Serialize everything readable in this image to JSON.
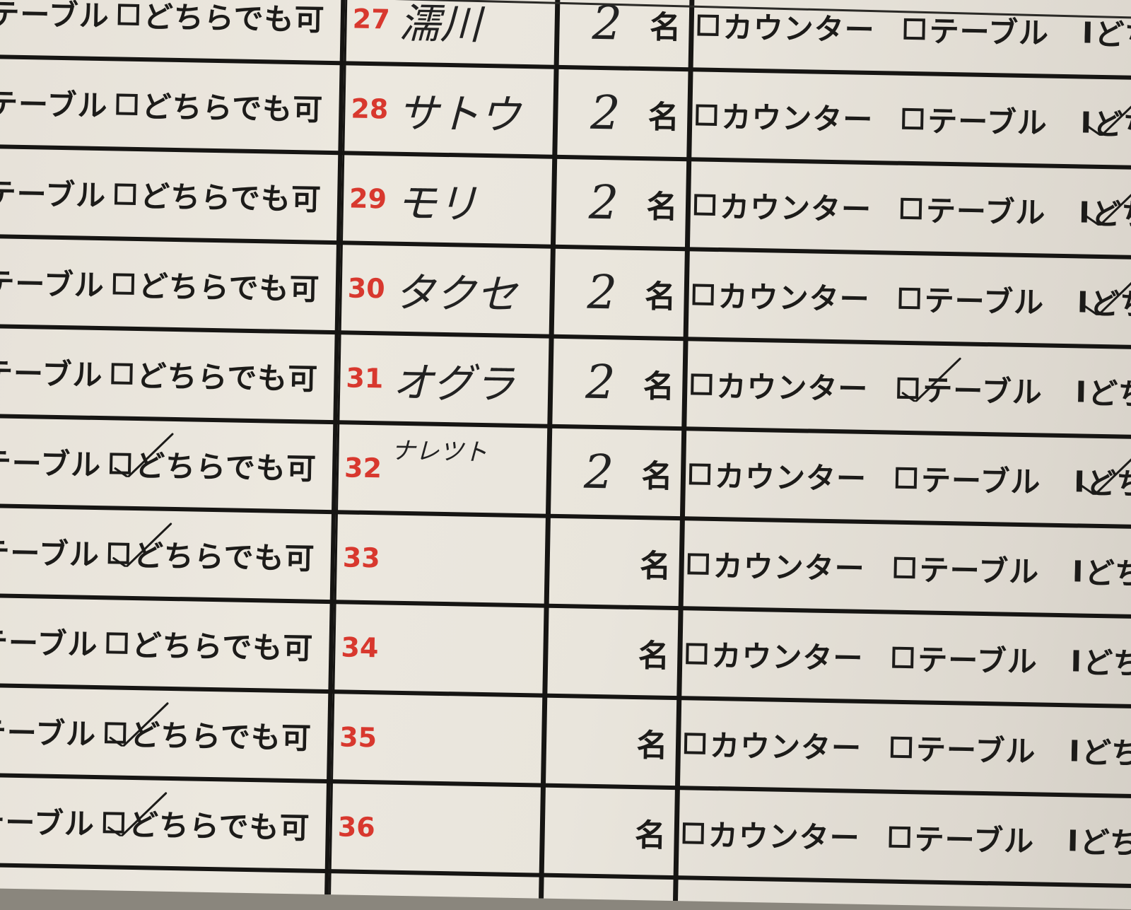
{
  "left_column": {
    "table_label": "テーブル",
    "either_label": "どちらでも可"
  },
  "labels": {
    "persons_unit": "名",
    "counter": "カウンター",
    "table": "テーブル",
    "either": "どちらでも可"
  },
  "reservations": [
    {
      "no": "27",
      "name": "濡川",
      "party": "2"
    },
    {
      "no": "28",
      "name": "サトウ",
      "party": "2"
    },
    {
      "no": "29",
      "name": "モリ",
      "party": "2"
    },
    {
      "no": "30",
      "name": "タクセ",
      "party": "2"
    },
    {
      "no": "31",
      "name": "オグラ",
      "party": "2"
    },
    {
      "no": "32",
      "name": "ナレツト",
      "party": "2"
    },
    {
      "no": "33",
      "name": "",
      "party": ""
    },
    {
      "no": "34",
      "name": "",
      "party": ""
    },
    {
      "no": "35",
      "name": "",
      "party": ""
    },
    {
      "no": "36",
      "name": "",
      "party": ""
    }
  ],
  "checked": {
    "left_either_rows": [
      "32",
      "33",
      "35",
      "36"
    ],
    "right_table_rows": [
      "31"
    ],
    "right_either_rows": [
      "28",
      "29",
      "30",
      "32"
    ]
  },
  "colors": {
    "number_red": "#d8382e",
    "ink": "#1c1b19",
    "paper": "#ece8df"
  }
}
